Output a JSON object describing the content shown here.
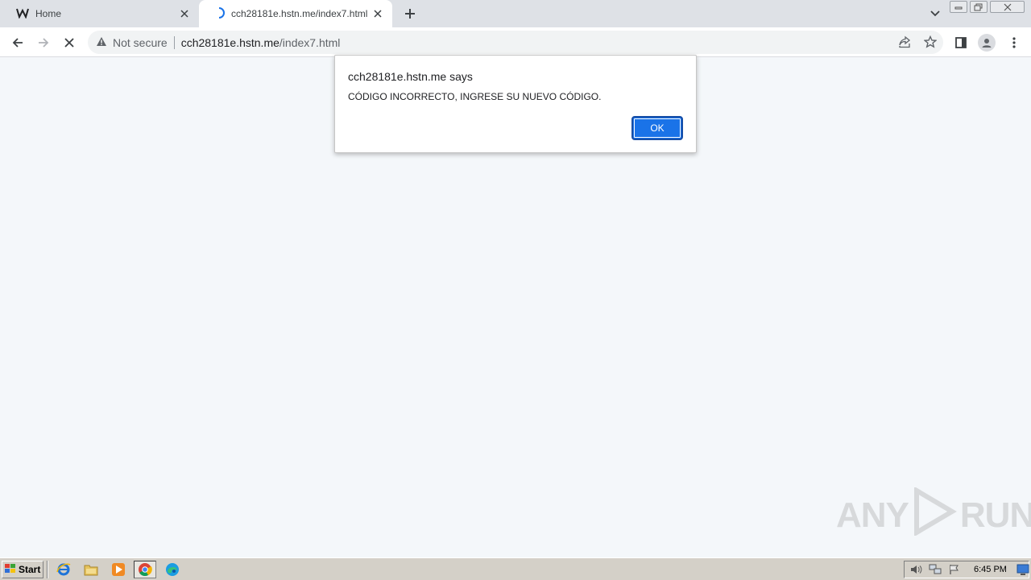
{
  "browser": {
    "tabs": [
      {
        "title": "Home",
        "icon": "w-logo-icon",
        "active": false
      },
      {
        "title": "cch28181e.hstn.me/index7.html",
        "icon": "loading-spinner-icon",
        "active": true
      }
    ],
    "omnibox": {
      "security_label": "Not secure",
      "url_host": "cch28181e.hstn.me",
      "url_path": "/index7.html"
    }
  },
  "dialog": {
    "title": "cch28181e.hstn.me says",
    "message": "CÓDIGO INCORRECTO, INGRESE SU NUEVO CÓDIGO.",
    "ok_label": "OK"
  },
  "watermark": {
    "left_text": "ANY",
    "right_text": "RUN"
  },
  "taskbar": {
    "start_label": "Start",
    "clock": "6:45 PM"
  },
  "colors": {
    "accent": "#1a73e8",
    "page_bg": "#f4f7fa",
    "tabstrip_bg": "#dee1e6",
    "taskbar_bg": "#d4d0c8"
  }
}
